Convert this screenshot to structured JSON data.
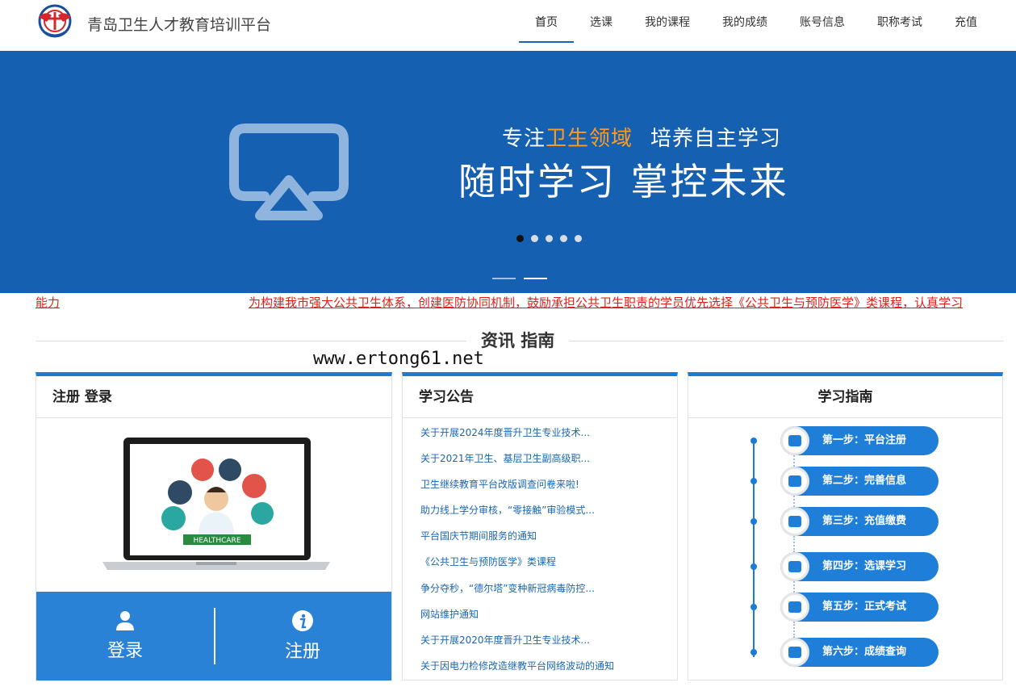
{
  "header": {
    "site_title": "青岛卫生人才教育培训平台",
    "nav": [
      "首页",
      "选课",
      "我的课程",
      "我的成绩",
      "账号信息",
      "职称考试",
      "充值"
    ]
  },
  "banner": {
    "sub_before": "专注",
    "sub_highlight": "卫生领域",
    "sub_after": "培养自主学习",
    "main": "随时学习 掌控未来",
    "highlight_color": "#ff9a1f",
    "background_color": "#1560b0"
  },
  "marquee": {
    "left_fragment": "能力",
    "text": "为构建我市强大公共卫生体系，创建医防协同机制，鼓励承担公共卫生职责的学员优先选择《公共卫生与预防医学》类课程，认真学习"
  },
  "section": {
    "title": "资讯 指南",
    "watermark": "www.ertong61.net"
  },
  "login_panel": {
    "title": "注册 登录",
    "laptop_badge": "HEALTHCARE",
    "login": "登录",
    "register": "注册"
  },
  "notice_panel": {
    "title": "学习公告",
    "items": [
      "关于开展2024年度晋升卫生专业技术...",
      "关于2021年卫生、基层卫生副高级职...",
      "卫生继续教育平台改版调查问卷来啦!",
      "助力线上学分审核，“零接触”审验模式...",
      "平台国庆节期间服务的通知",
      "《公共卫生与预防医学》类课程",
      "争分夺秒，“德尔塔”变种新冠病毒防控...",
      "网站维护通知",
      "关于开展2020年度晋升卫生专业技术...",
      "关于因电力检修改造继教平台网络波动的通知"
    ]
  },
  "guide_panel": {
    "title": "学习指南",
    "steps": [
      {
        "label": "第一步：平台注册",
        "icon": "home-icon"
      },
      {
        "label": "第二步：完善信息",
        "icon": "info-icon"
      },
      {
        "label": "第三步：充值缴费",
        "icon": "database-icon"
      },
      {
        "label": "第四步：选课学习",
        "icon": "monitor-icon"
      },
      {
        "label": "第五步：正式考试",
        "icon": "tablet-icon"
      },
      {
        "label": "第六步：成绩查询",
        "icon": "keyboard-icon"
      }
    ]
  },
  "colors": {
    "primary": "#1b7bd5",
    "nav_active": "#1b66b1",
    "marquee": "#e0201b"
  }
}
